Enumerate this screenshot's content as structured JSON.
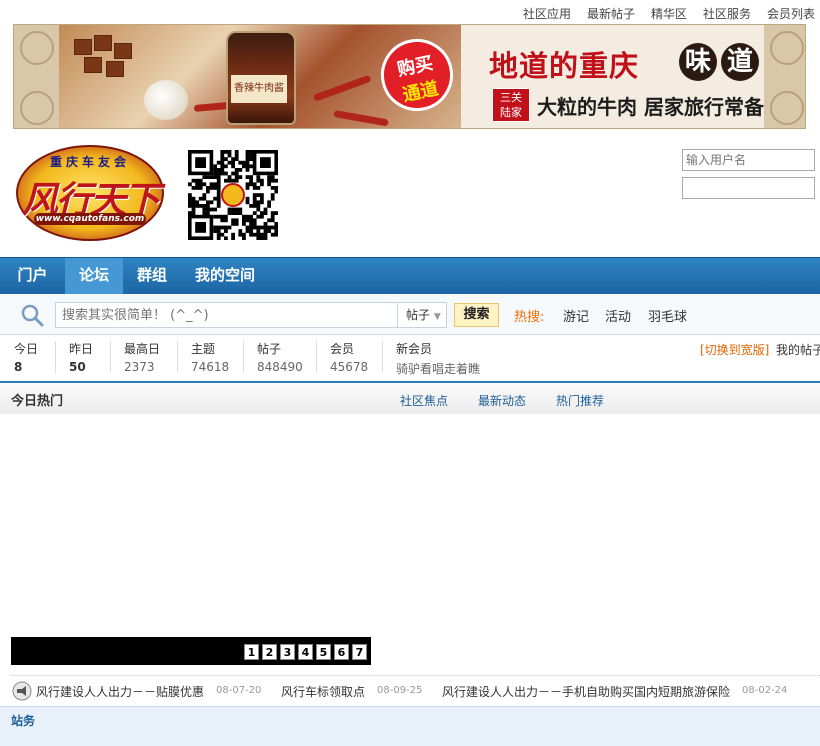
{
  "top_links": [
    "社区应用",
    "最新帖子",
    "精华区",
    "社区服务",
    "会员列表"
  ],
  "banner": {
    "badge_line1": "购买",
    "badge_line2": "通道",
    "slogan_main": "地道的重庆",
    "flavor_1": "味",
    "flavor_2": "道",
    "brand": "三关\n陆家",
    "slogan_sub": "大粒的牛肉  居家旅行常备",
    "jar_label": "香辣牛肉酱"
  },
  "logo": {
    "top_text": "重庆车友会",
    "main_text": "风行天下",
    "url_text": "www.cqautofans.com"
  },
  "login": {
    "username_placeholder": "输入用户名"
  },
  "nav": {
    "items": [
      "门户",
      "论坛",
      "群组",
      "我的空间"
    ],
    "active_index": 1
  },
  "search": {
    "placeholder": "搜索其实很简单！ (^_^)",
    "type_value": "帖子",
    "button_label": "搜索",
    "hot_label": "热搜:",
    "hot_words": [
      "游记",
      "活动",
      "羽毛球"
    ]
  },
  "stats": {
    "items": [
      {
        "label": "今日",
        "value": "8"
      },
      {
        "label": "昨日",
        "value": "50"
      },
      {
        "label": "最高日",
        "value": "2373"
      },
      {
        "label": "主题",
        "value": "74618"
      },
      {
        "label": "帖子",
        "value": "848490"
      },
      {
        "label": "会员",
        "value": "45678"
      },
      {
        "label": "新会员",
        "value": "骑驴看唱走着瞧"
      }
    ],
    "switch_wide": "[切换到宽版]",
    "my_posts": "我的帖子"
  },
  "today_hot": {
    "title": "今日热门",
    "tabs": [
      "社区焦点",
      "最新动态",
      "热门推荐"
    ],
    "slide_numbers": [
      "1",
      "2",
      "3",
      "4",
      "5",
      "6",
      "7"
    ]
  },
  "announcements": [
    {
      "text": "风行建设人人出力－－贴膜优惠",
      "date": "08-07-20"
    },
    {
      "text": "风行车标领取点",
      "date": "08-09-25"
    },
    {
      "text": "风行建设人人出力－－手机自助购买国内短期旅游保险",
      "date": "08-02-24"
    }
  ],
  "station": {
    "title": "站务"
  },
  "colors": {
    "nav_blue": "#1d65a4",
    "nav_active": "#4598d4",
    "hot_orange": "#f26c00",
    "link_blue": "#1d5d97",
    "banner_red": "#c2101b"
  }
}
